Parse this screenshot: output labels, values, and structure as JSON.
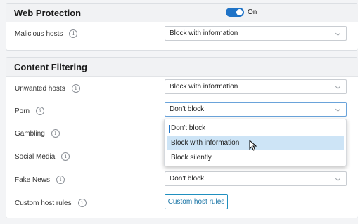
{
  "web_protection": {
    "title": "Web Protection",
    "toggle_label": "On",
    "toggle_color": "#1f73c7",
    "rows": [
      {
        "label": "Malicious hosts",
        "value": "Block with information"
      }
    ]
  },
  "content_filtering": {
    "title": "Content Filtering",
    "rows": [
      {
        "label": "Unwanted hosts",
        "value": "Block with information"
      },
      {
        "label": "Porn",
        "value": "Don't block"
      },
      {
        "label": "Gambling"
      },
      {
        "label": "Social Media"
      },
      {
        "label": "Fake News",
        "value": "Don't block"
      },
      {
        "label": "Custom host rules",
        "button": "Custom host rules"
      }
    ]
  },
  "dropdown": {
    "options": [
      "Don't block",
      "Block with information",
      "Block silently"
    ],
    "hovered": "Block with information"
  },
  "info_glyph": "i",
  "colors": {
    "accent": "#1f73c7",
    "hover": "#cde4f6"
  }
}
